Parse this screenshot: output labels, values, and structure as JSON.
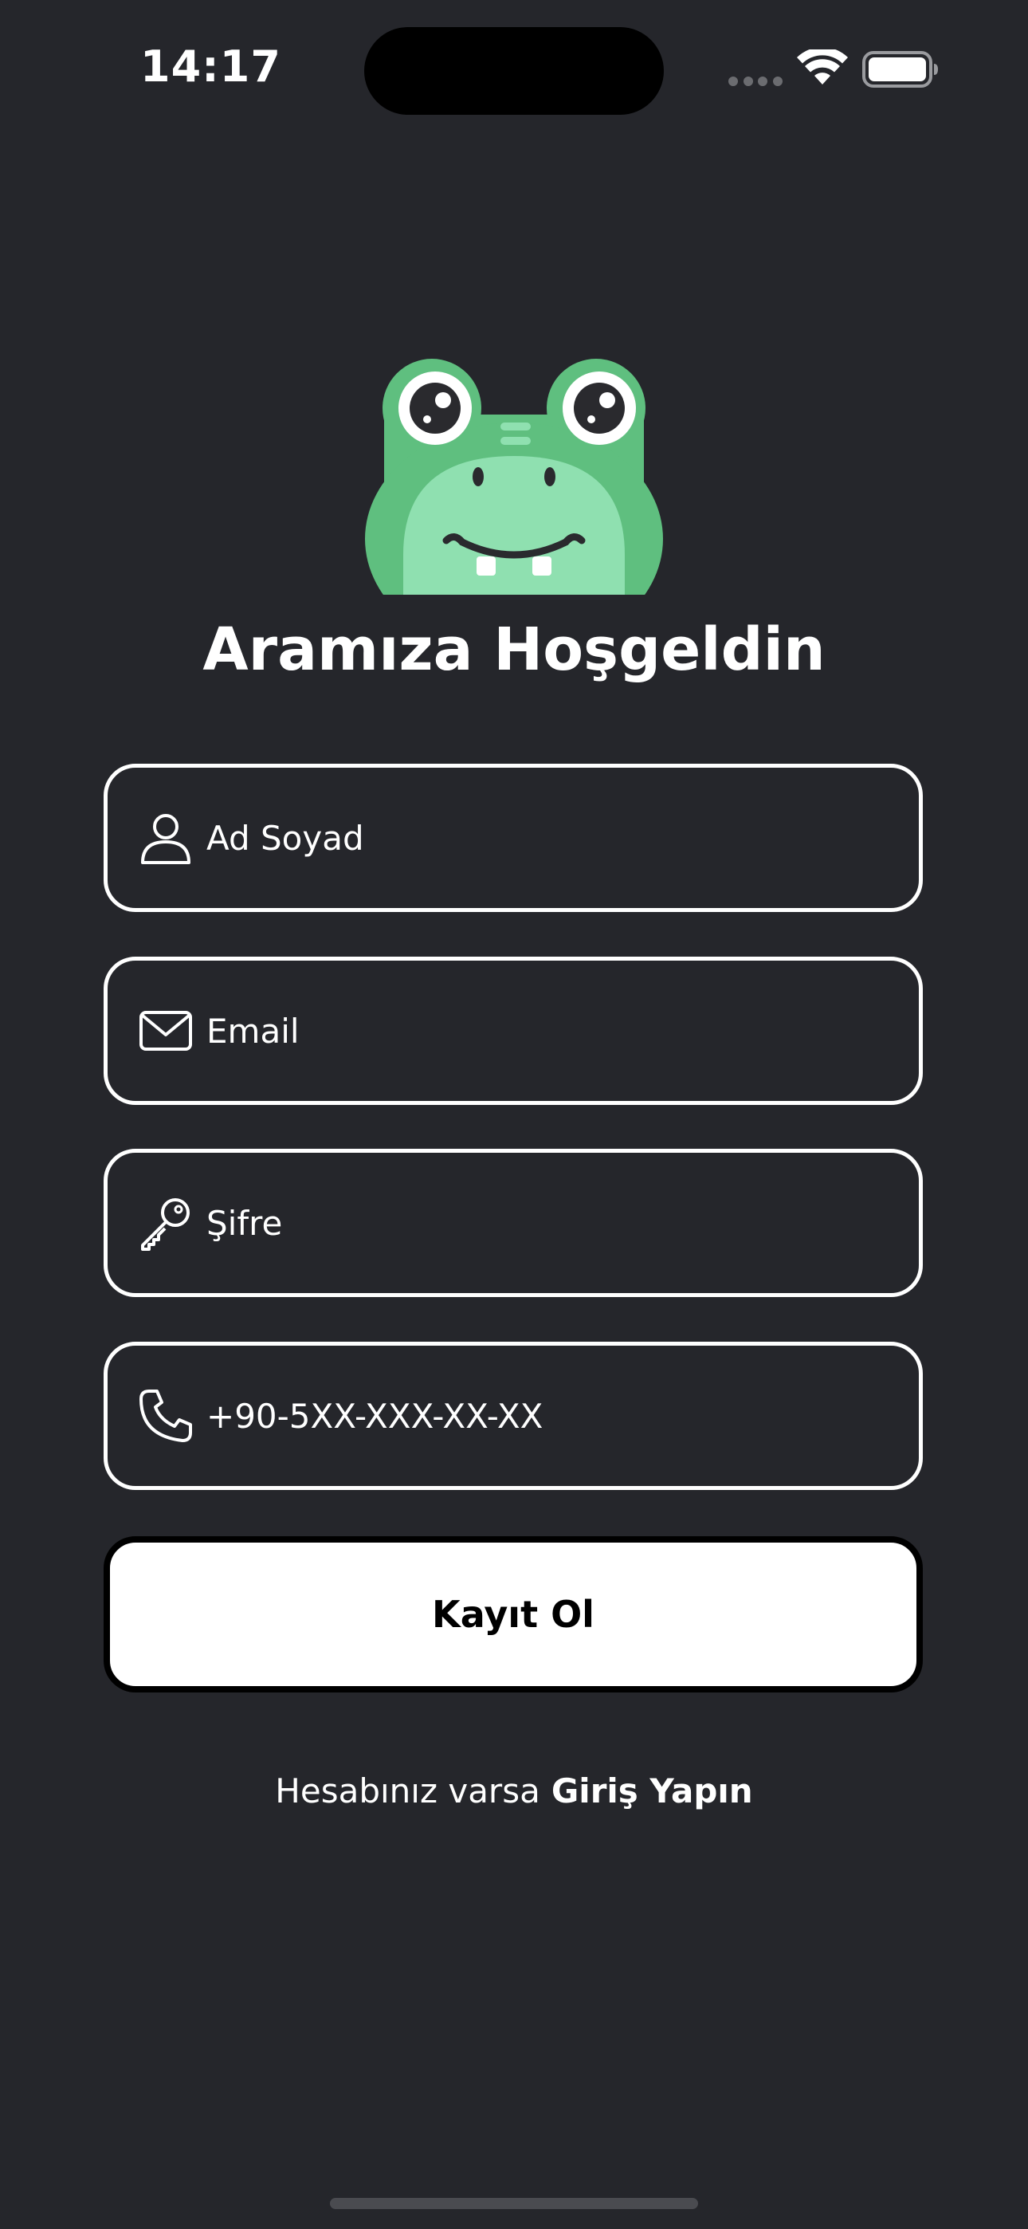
{
  "status_bar": {
    "time": "14:17"
  },
  "welcome": {
    "title": "Aramıza Hoşgeldin"
  },
  "form": {
    "name_placeholder": "Ad Soyad",
    "email_placeholder": "Email",
    "password_placeholder": "Şifre",
    "phone_placeholder": "+90-5XX-XXX-XX-XX",
    "submit_label": "Kayıt Ol"
  },
  "footer": {
    "prompt": "Hesabınız varsa",
    "login_link": "Giriş Yapın"
  },
  "colors": {
    "background": "#25262b",
    "text": "#ffffff",
    "mascot_green": "#5fbf7f",
    "mascot_light_green": "#8fe0b0"
  },
  "icons": {
    "name": "person-icon",
    "email": "envelope-icon",
    "password": "key-icon",
    "phone": "phone-icon"
  }
}
